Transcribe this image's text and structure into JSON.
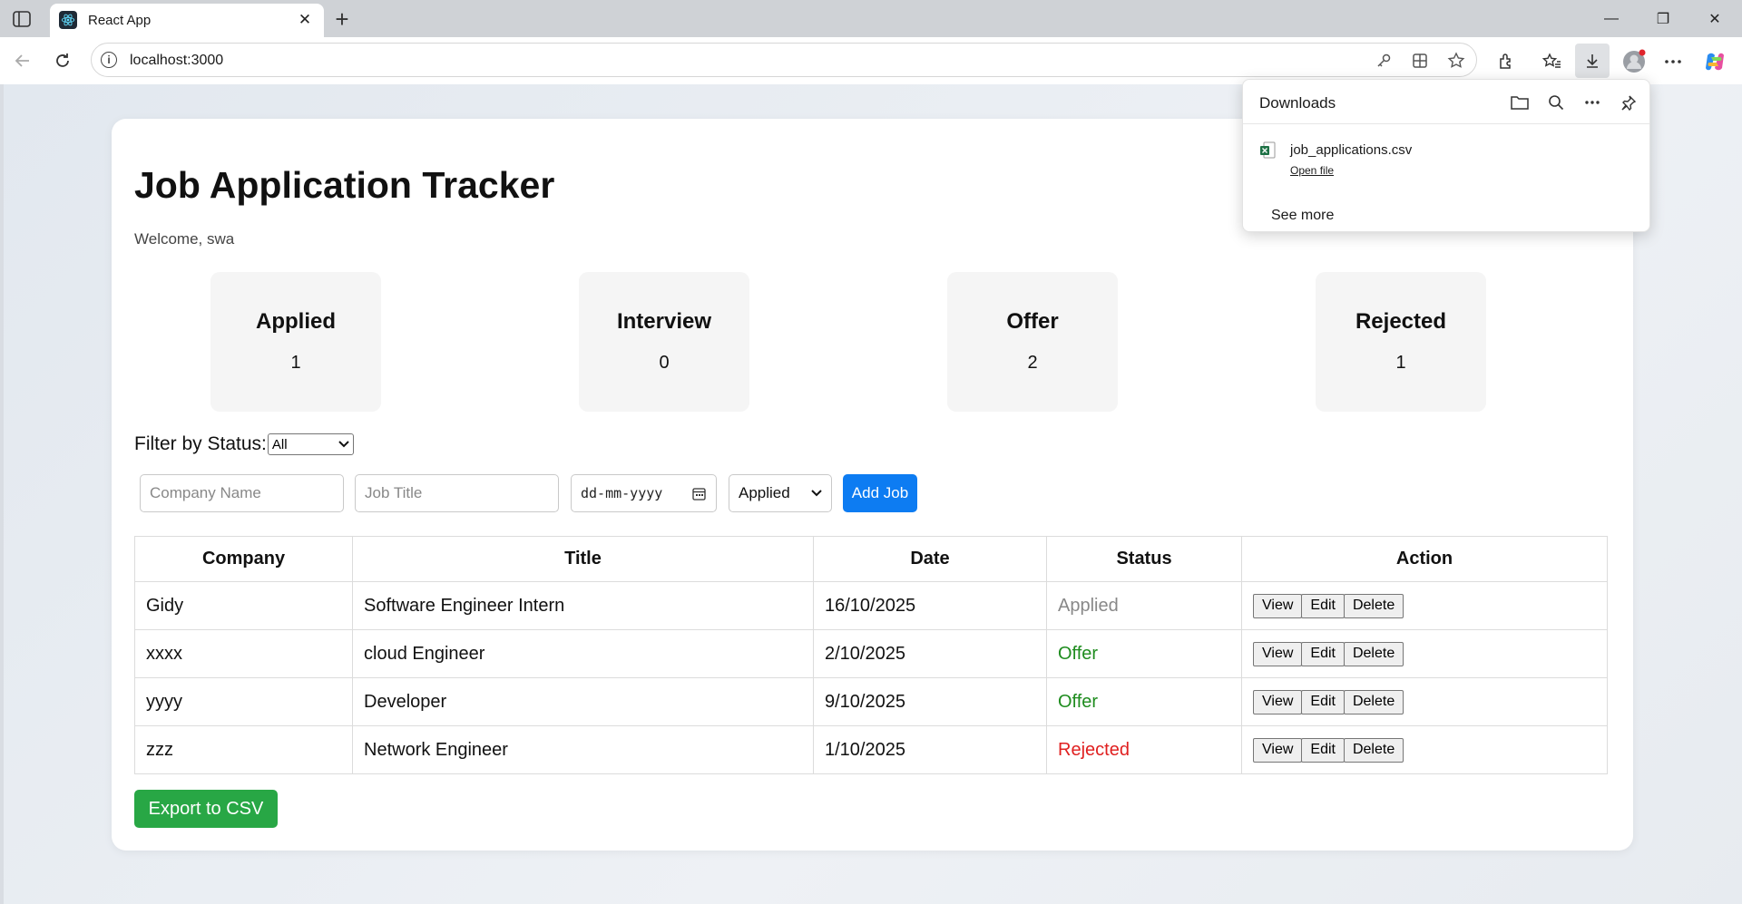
{
  "browser": {
    "tab_title": "React App",
    "tab_close": "✕",
    "new_tab": "+",
    "url": "localhost:3000",
    "window_controls": {
      "minimize": "—",
      "restore": "❐",
      "close": "✕"
    },
    "icons": [
      "sidebar-icon",
      "react-favicon",
      "back-icon",
      "reload-icon",
      "info-icon",
      "key-icon",
      "apps-icon",
      "favorite-star-icon",
      "extensions-icon",
      "favorites-icon",
      "downloads-icon",
      "profile-icon",
      "more-icon",
      "copilot-icon"
    ]
  },
  "downloads": {
    "title": "Downloads",
    "file_name": "job_applications.csv",
    "open_label": "Open file",
    "see_more": "See more"
  },
  "app": {
    "title": "Job Application Tracker",
    "welcome": "Welcome, swa",
    "stats": [
      {
        "label": "Applied",
        "count": "1"
      },
      {
        "label": "Interview",
        "count": "0"
      },
      {
        "label": "Offer",
        "count": "2"
      },
      {
        "label": "Rejected",
        "count": "1"
      }
    ],
    "filter": {
      "label": "Filter by Status:",
      "value": "All"
    },
    "form": {
      "company_placeholder": "Company Name",
      "title_placeholder": "Job Title",
      "date_placeholder": "dd-mm-yyyy",
      "status_value": "Applied",
      "add_label": "Add Job"
    },
    "table": {
      "headers": [
        "Company",
        "Title",
        "Date",
        "Status",
        "Action"
      ],
      "rows": [
        {
          "company": "Gidy",
          "title": "Software Engineer Intern",
          "date": "16/10/2025",
          "status": "Applied"
        },
        {
          "company": "xxxx",
          "title": "cloud Engineer",
          "date": "2/10/2025",
          "status": "Offer"
        },
        {
          "company": "yyyy",
          "title": "Developer",
          "date": "9/10/2025",
          "status": "Offer"
        },
        {
          "company": "zzz",
          "title": "Network Engineer",
          "date": "1/10/2025",
          "status": "Rejected"
        }
      ],
      "actions": {
        "view": "View",
        "edit": "Edit",
        "delete": "Delete"
      }
    },
    "export_label": "Export to CSV",
    "colors": {
      "applied": "#888888",
      "offer": "#1e8c1e",
      "rejected": "#e02020",
      "primary": "#0d7cf2",
      "export": "#28a745"
    }
  }
}
